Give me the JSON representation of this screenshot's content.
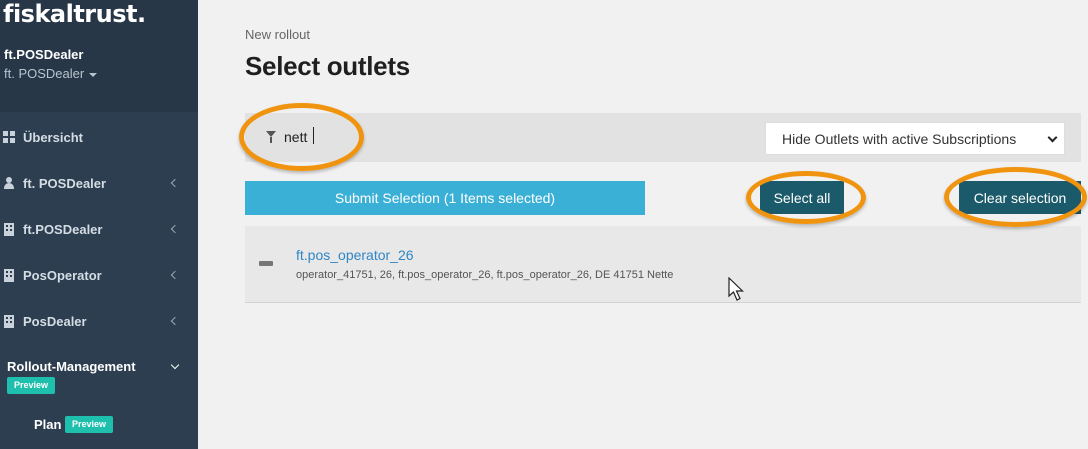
{
  "sidebar": {
    "logo": "fiskaltrust.",
    "user_name": "ft.POSDealer",
    "user_role": "ft. POSDealer",
    "items": [
      {
        "label": "Übersicht",
        "icon": "dashboard-icon"
      },
      {
        "label": "ft. POSDealer",
        "icon": "user-icon"
      },
      {
        "label": "ft.POSDealer",
        "icon": "building-icon"
      },
      {
        "label": "PosOperator",
        "icon": "building-icon"
      },
      {
        "label": "PosDealer",
        "icon": "building-icon"
      }
    ],
    "rollout": {
      "label": "Rollout-Management",
      "badge": "Preview"
    },
    "plan": {
      "label": "Plan",
      "badge": "Preview"
    }
  },
  "main": {
    "breadcrumb": "New rollout",
    "title": "Select outlets",
    "filter": {
      "value": "nett",
      "placeholder": ""
    },
    "subscription_filter": "Hide Outlets with active Subscriptions",
    "submit_label": "Submit Selection (1 Items selected)",
    "select_all_label": "Select all",
    "clear_label": "Clear selection",
    "outlets": [
      {
        "name": "ft.pos_operator_26",
        "details": "operator_41751, 26, ft.pos_operator_26, ft.pos_operator_26, DE 41751 Nette"
      }
    ]
  },
  "colors": {
    "sidebar": "#2c3e4f",
    "accent": "#3bb0d6",
    "dark_button": "#1b5a6a",
    "highlight": "#f0940f",
    "badge": "#1fbfae",
    "link": "#2f86c6"
  }
}
